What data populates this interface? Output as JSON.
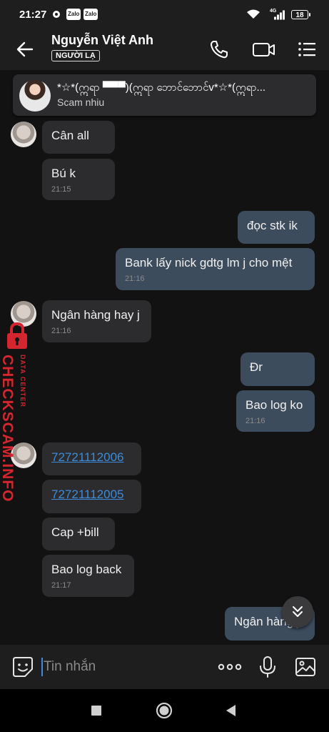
{
  "status": {
    "time": "21:27",
    "battery": "18",
    "network": "4G"
  },
  "contact": {
    "name": "Nguyễn Việt Anh",
    "badge": "NGƯỜI LẠ"
  },
  "pinned": {
    "title": "*☆*(ဣရာ ▀▀▀)(ဣရာ ဘောင်ဘောင်v*☆*(ဣရာ...",
    "subtitle": "Scam nhiu"
  },
  "messages": [
    {
      "text": "Cân all"
    },
    {
      "text": "Bú k",
      "time": "21:15"
    },
    {
      "text": "đọc stk ik"
    },
    {
      "text": "Bank lấy nick gdtg lm j cho mệt",
      "time": "21:16"
    },
    {
      "text": "Ngân hàng hay j",
      "time": "21:16"
    },
    {
      "text": "Đr"
    },
    {
      "text": "Bao log ko",
      "time": "21:16"
    },
    {
      "text": "72721112006"
    },
    {
      "text": "72721112005"
    },
    {
      "text": "Cap +bill"
    },
    {
      "text": "Bao log back",
      "time": "21:17"
    },
    {
      "text": "Ngân hàng j"
    }
  ],
  "watermark": {
    "brand": "CHECKSCAM.INFO",
    "tagline": "DATA CENTER"
  },
  "input": {
    "placeholder": "Tin nhắn"
  },
  "colors": {
    "incoming": "#2c2c2e",
    "outgoing": "#3d4c5d",
    "link": "#3d8bd9",
    "watermark": "#d3262e"
  }
}
